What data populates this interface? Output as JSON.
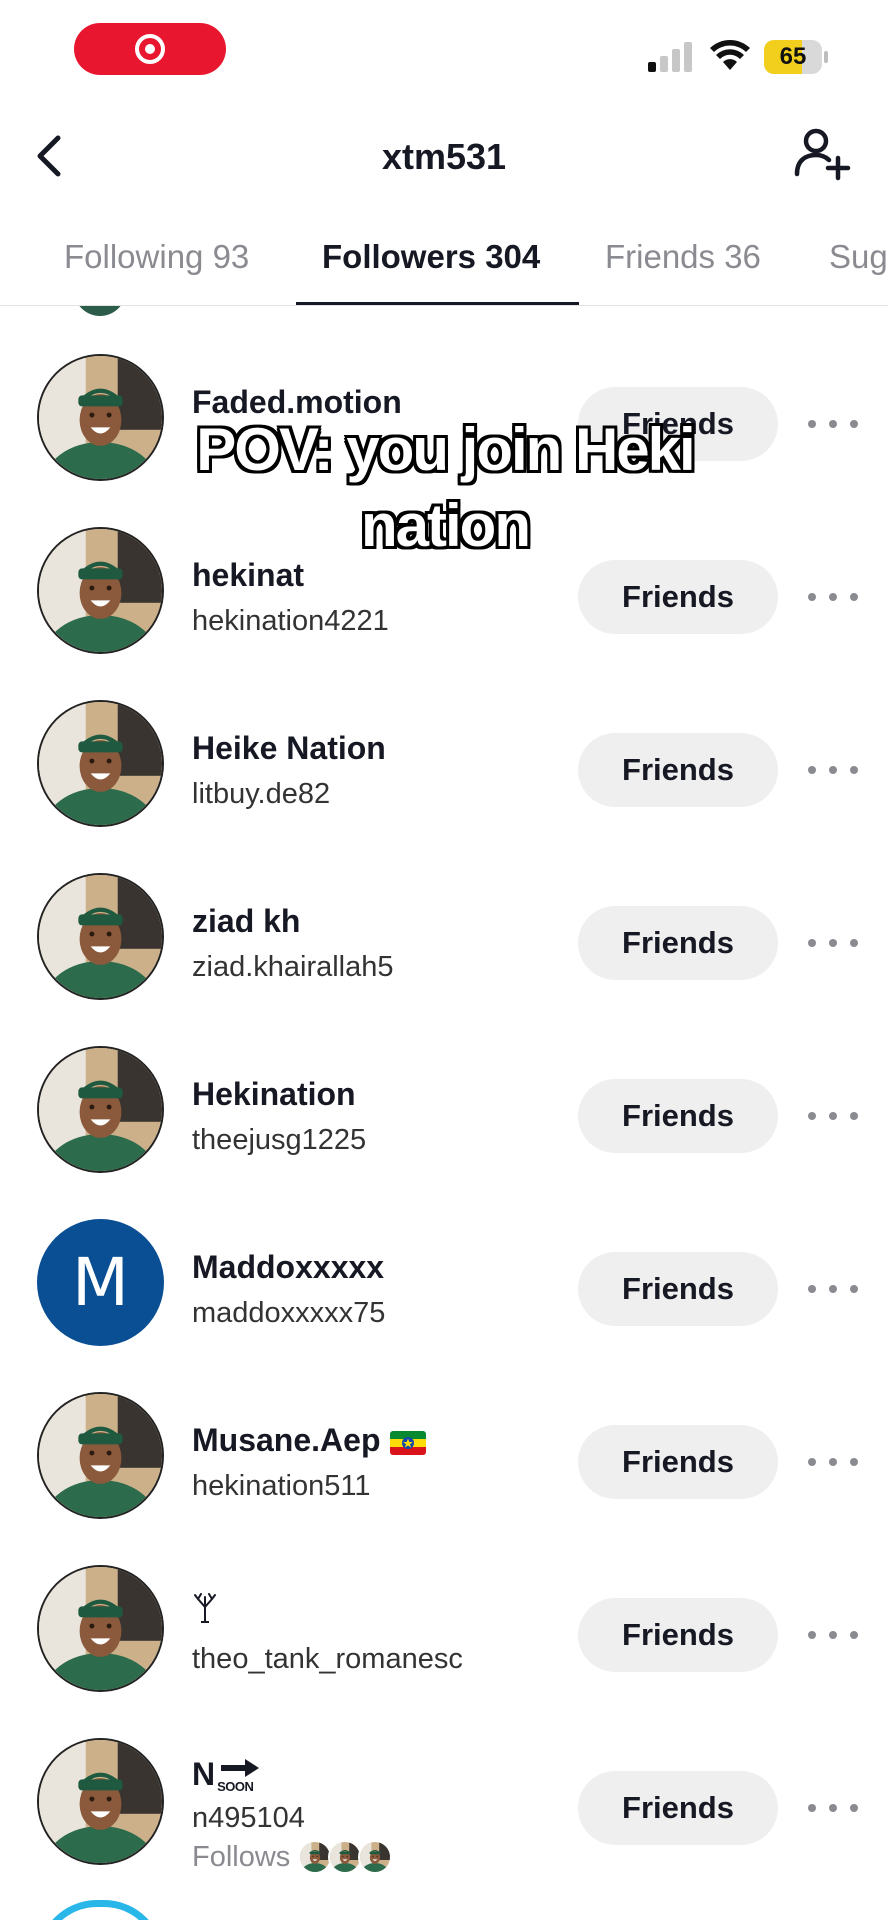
{
  "status_bar": {
    "battery_level": "65",
    "battery_fraction": 0.65,
    "signal_bars_active": 1
  },
  "header": {
    "title": "xtm531"
  },
  "tabs": [
    {
      "label": "Following 93",
      "active": false
    },
    {
      "label": "Followers 304",
      "active": true
    },
    {
      "label": "Friends 36",
      "active": false
    },
    {
      "label": "Sug",
      "active": false
    }
  ],
  "overlay_caption": "POV: you join Heki nation",
  "list": [
    {
      "name": "Faded.motion",
      "handle": "",
      "button": "Friends"
    },
    {
      "name": "hekinat",
      "handle": "hekination4221",
      "button": "Friends"
    },
    {
      "name": "Heike Nation",
      "handle": "litbuy.de82",
      "button": "Friends"
    },
    {
      "name": "ziad kh",
      "handle": "ziad.khairallah5",
      "button": "Friends"
    },
    {
      "name": "Hekination",
      "handle": "theejusg1225",
      "button": "Friends"
    },
    {
      "name": "Maddoxxxxx",
      "handle": "maddoxxxxx75",
      "button": "Friends",
      "avatar_letter": "M"
    },
    {
      "name": "Musane.Aep",
      "handle": "hekination511",
      "button": "Friends"
    },
    {
      "name": "",
      "handle": "theo_tank_romanesc",
      "button": "Friends"
    },
    {
      "name": "N",
      "badge": "SOON",
      "handle": "n495104",
      "button": "Friends",
      "follows_label": "Follows"
    }
  ],
  "colors": {
    "record_red": "#e8172f",
    "battery_yellow": "#f2cf1d",
    "button_gray": "#efefef",
    "letter_avatar_blue": "#0a4f94"
  }
}
